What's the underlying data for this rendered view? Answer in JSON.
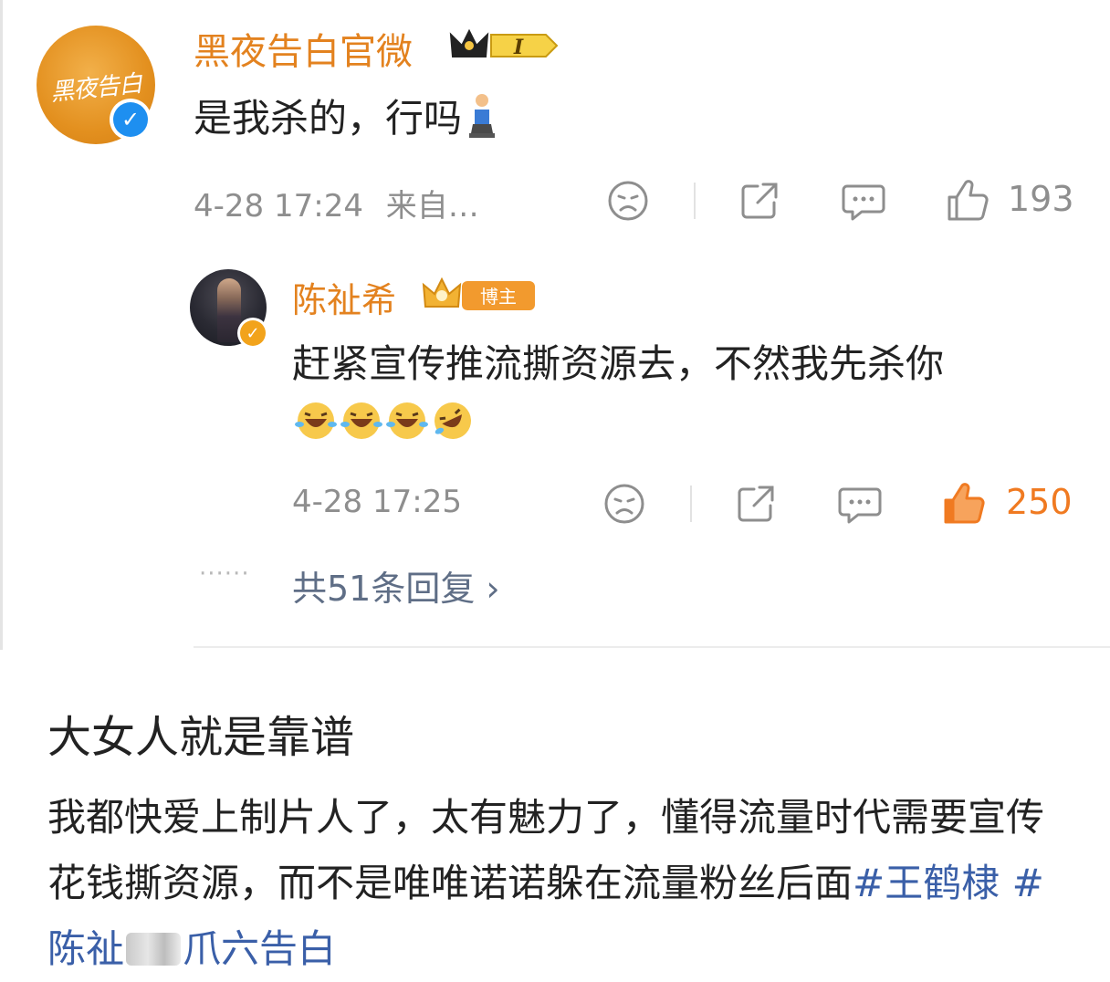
{
  "comment": {
    "author": "黑夜告白官微",
    "avatar_text": "黑夜告白",
    "level": "I",
    "text": "是我杀的，行吗",
    "time": "4-28 17:24",
    "source": "来自…",
    "like_count": "193"
  },
  "reply": {
    "author": "陈祉希",
    "badge_label": "博主",
    "text": "赶紧宣传推流撕资源去，不然我先杀你",
    "time": "4-28 17:25",
    "like_count": "250"
  },
  "reply_thread": {
    "dots": "······",
    "link_label": "共51条回复 ›"
  },
  "post": {
    "title": "大女人就是靠谱",
    "body": "我都快爱上制片人了，太有魅力了，懂得流量时代需要宣传花钱撕资源，而不是唯唯诺诺躲在流量粉丝后面",
    "hashtag_1": "#王鹤棣",
    "hashtag_2_start": "#陈祉",
    "hashtag_3": "爪六告白"
  },
  "colors": {
    "name_orange": "#e3821f",
    "like_active": "#f07a21",
    "meta_grey": "#8e8e8e",
    "link_blue": "#5f6e86",
    "hashtag_blue": "#3a5fa8",
    "verified_blue": "#1e8ff0",
    "verified_orange": "#f2a31b"
  }
}
